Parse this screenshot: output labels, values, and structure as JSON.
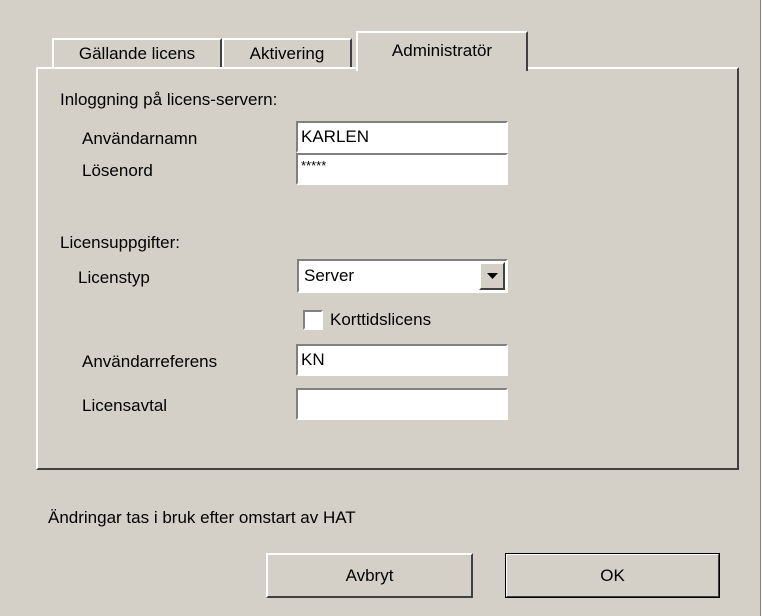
{
  "tabs": [
    {
      "label": "Gällande licens"
    },
    {
      "label": "Aktivering"
    },
    {
      "label": "Administratör"
    }
  ],
  "login": {
    "heading": "Inloggning på licens-servern:",
    "username_label": "Användarnamn",
    "username_value": "KARLEN",
    "password_label": "Lösenord",
    "password_value": "*****"
  },
  "license": {
    "heading": "Licensuppgifter:",
    "type_label": "Licenstyp",
    "type_value": "Server",
    "short_term_label": "Korttidslicens",
    "short_term_checked": false,
    "user_ref_label": "Användarreferens",
    "user_ref_value": "KN",
    "agreement_label": "Licensavtal",
    "agreement_value": ""
  },
  "notice": "Ändringar tas i bruk efter omstart av HAT",
  "buttons": {
    "cancel": "Avbryt",
    "ok": "OK"
  },
  "colors": {
    "face": "#d4d0c8",
    "highlight": "#ffffff",
    "shadow": "#808080",
    "dark_shadow": "#404040"
  },
  "icons": {
    "dropdown": "chevron-down-icon"
  }
}
